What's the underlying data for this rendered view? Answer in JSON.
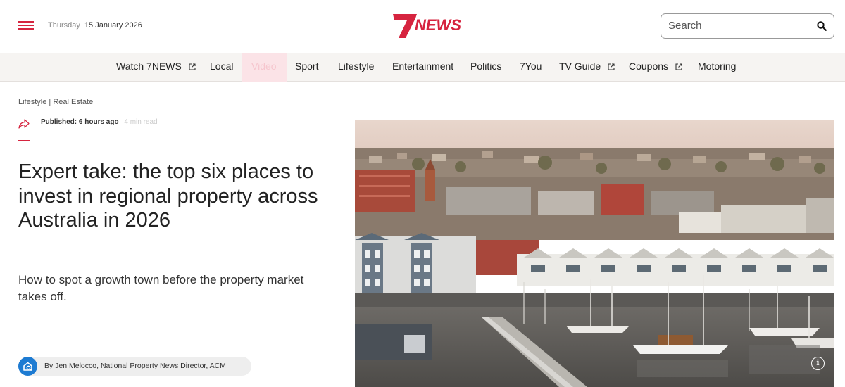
{
  "header": {
    "date_weekday": "Thursday",
    "date_full": "15 January 2026",
    "logo_seven": "7",
    "logo_news": "NEWS",
    "search_placeholder": "Search",
    "brand_color": "#d6243f"
  },
  "nav": {
    "items": [
      {
        "label": "Watch 7NEWS",
        "external": true
      },
      {
        "label": "Local",
        "external": false
      },
      {
        "label": "Video",
        "external": false,
        "active": true
      },
      {
        "label": "Sport",
        "external": false
      },
      {
        "label": "Lifestyle",
        "external": false
      },
      {
        "label": "Entertainment",
        "external": false
      },
      {
        "label": "Politics",
        "external": false
      },
      {
        "label": "7You",
        "external": false
      },
      {
        "label": "TV Guide",
        "external": true
      },
      {
        "label": "Coupons",
        "external": true
      },
      {
        "label": "Motoring",
        "external": false
      }
    ]
  },
  "article": {
    "breadcrumb_section": "Lifestyle",
    "breadcrumb_sep": " | ",
    "breadcrumb_subsection": "Real Estate",
    "published_label": "Published:",
    "published_time": "6 hours ago",
    "read_time": "4 min read",
    "headline": "Expert take: the top six places to invest in regional property across Australia in 2026",
    "subhead": "How to spot a growth town before the property market takes off.",
    "byline": "By Jen Melocco, National Property News Director, ACM",
    "hero_info": "i"
  }
}
